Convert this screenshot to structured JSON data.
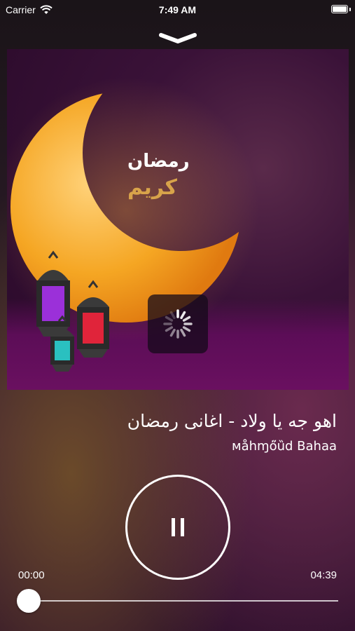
{
  "status_bar": {
    "carrier": "Carrier",
    "time": "7:49 AM",
    "battery_level": 1.0
  },
  "artwork": {
    "ramadan_line1": "رمضان",
    "ramadan_line2": "كريم",
    "loading": true
  },
  "track": {
    "title": "اهو جه يا ولاد - اغانى رمضان",
    "artist": "ᴍåhɱő̈ȕd Bahaa"
  },
  "player": {
    "state_icon": "pause-icon",
    "elapsed": "00:00",
    "duration": "04:39",
    "progress_fraction": 0.0
  },
  "colors": {
    "accent": "#ffffff",
    "moon": "#f5a623",
    "karim": "#d8a34a"
  }
}
